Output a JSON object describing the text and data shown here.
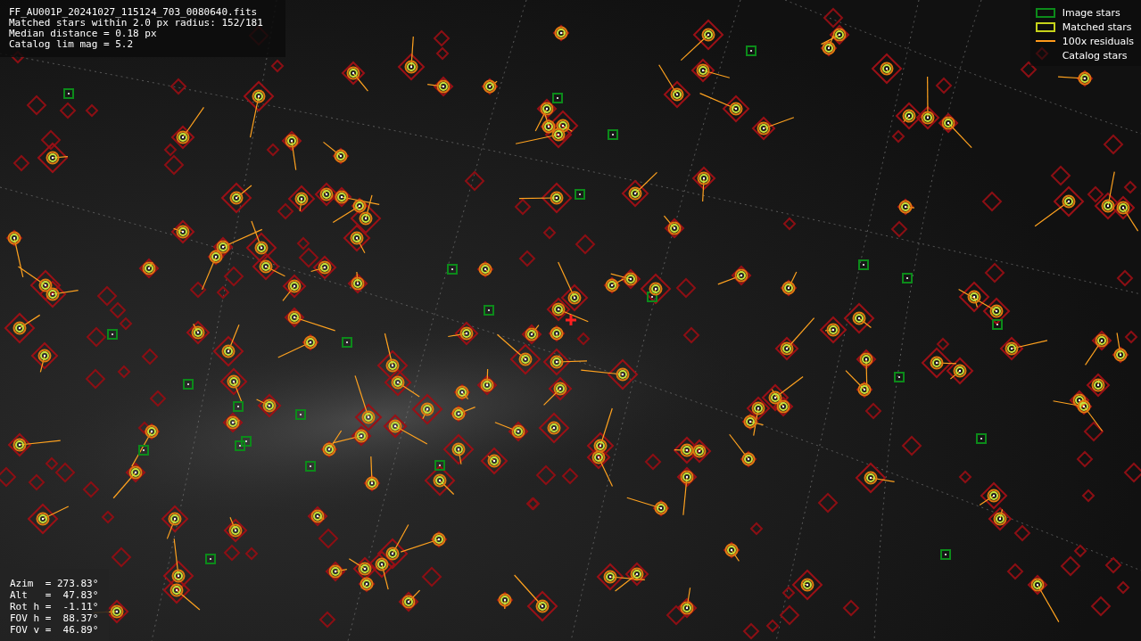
{
  "header": {
    "lines": [
      "FF_AU001P_20241027_115124_703_0080640.fits",
      "Matched stars within 2.0 px radius: 152/181",
      "Median distance = 0.18 px",
      "Catalog lim mag = 5.2"
    ]
  },
  "legend": [
    {
      "kind": "image",
      "label": "Image stars"
    },
    {
      "kind": "matched",
      "label": "Matched stars"
    },
    {
      "kind": "residual",
      "label": "100x residuals"
    },
    {
      "kind": "catalog",
      "label": "Catalog stars"
    }
  ],
  "pointing": {
    "lines": [
      "Azim  = 273.83°",
      "Alt   =  47.83°",
      "Rot h =  -1.11°",
      "FOV h =  88.37°",
      "FOV v =  46.89°"
    ]
  }
}
